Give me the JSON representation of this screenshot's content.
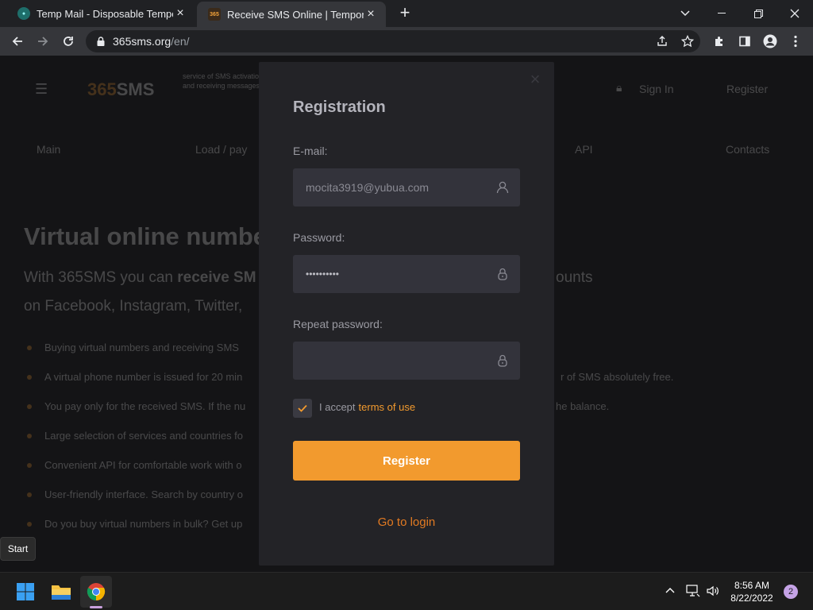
{
  "browser": {
    "tabs": [
      {
        "title": "Temp Mail - Disposable Tempora",
        "favicon": "tempmail-icon",
        "active": false
      },
      {
        "title": "Receive SMS Online | Temporary",
        "favicon": "365sms-icon",
        "active": true
      }
    ],
    "url_host": "365sms.org",
    "url_path": "/en/"
  },
  "background": {
    "logo_accent": "365",
    "logo_rest": "SMS",
    "slogan": "service of SMS activations and receiving messages",
    "sign_in": "Sign In",
    "register": "Register",
    "nav": [
      "Main",
      "Load / pay",
      "API",
      "Contacts"
    ],
    "headline": "Virtual online numbe",
    "lead_line1_a": "With 365SMS you can ",
    "lead_line1_b": "receive SM",
    "lead_line1_c": "ounts",
    "lead_line2": "on Facebook, Instagram, Twitter,",
    "bullets": [
      "Buying virtual numbers and receiving SMS",
      "A virtual phone number is issued for 20 min",
      "You pay only for the received SMS. If the nu",
      "Large selection of services and countries fo",
      "Convenient API for comfortable work with o",
      "User-friendly interface. Search by country o",
      "Do you buy virtual numbers in bulk? Get up"
    ],
    "bullet_right_1": "r of SMS absolutely free.",
    "bullet_right_2": "he balance."
  },
  "modal": {
    "title": "Registration",
    "email_label": "E-mail:",
    "email_value": "mocita3919@yubua.com",
    "password_label": "Password:",
    "password_value": "••••••••••",
    "repeat_label": "Repeat password:",
    "repeat_value": "",
    "accept_text": "I accept",
    "terms_link": "terms of use",
    "register_button": "Register",
    "go_to_login": "Go to login",
    "accent_color": "#f29a2e"
  },
  "tooltip": "Start",
  "taskbar": {
    "time": "8:56 AM",
    "date": "8/22/2022",
    "notifications": "2"
  }
}
